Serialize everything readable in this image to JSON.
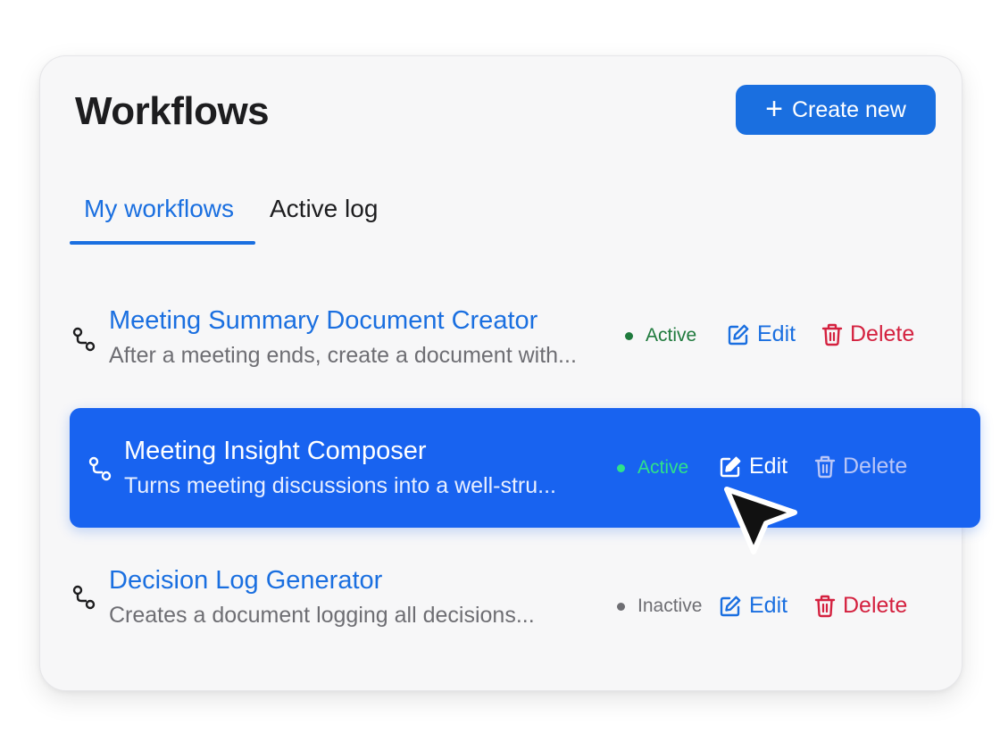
{
  "header": {
    "title": "Workflows",
    "create_label": "Create new"
  },
  "tabs": [
    {
      "label": "My workflows",
      "active": true
    },
    {
      "label": "Active log",
      "active": false
    }
  ],
  "workflows": [
    {
      "name": "Meeting Summary Document Creator",
      "description": "After a meeting ends, create a document with...",
      "status": "Active",
      "edit_label": "Edit",
      "delete_label": "Delete"
    },
    {
      "name": "Meeting Insight Composer",
      "description": "Turns meeting discussions into a well-stru...",
      "status": "Active",
      "edit_label": "Edit",
      "delete_label": "Delete",
      "selected": true
    },
    {
      "name": "Decision Log Generator",
      "description": "Creates a document logging all decisions...",
      "status": "Inactive",
      "edit_label": "Edit",
      "delete_label": "Delete"
    }
  ],
  "colors": {
    "accent": "#1a6fe0",
    "selected_row": "#1863f0",
    "active_status": "#1f7a3d",
    "active_status_on_blue": "#2ee28a",
    "inactive_status": "#6e6e73",
    "delete": "#d4213f"
  },
  "icons": {
    "workflow": "workflow-icon",
    "plus": "plus-icon",
    "edit": "edit-icon",
    "delete": "trash-icon",
    "cursor": "mouse-cursor-icon"
  }
}
